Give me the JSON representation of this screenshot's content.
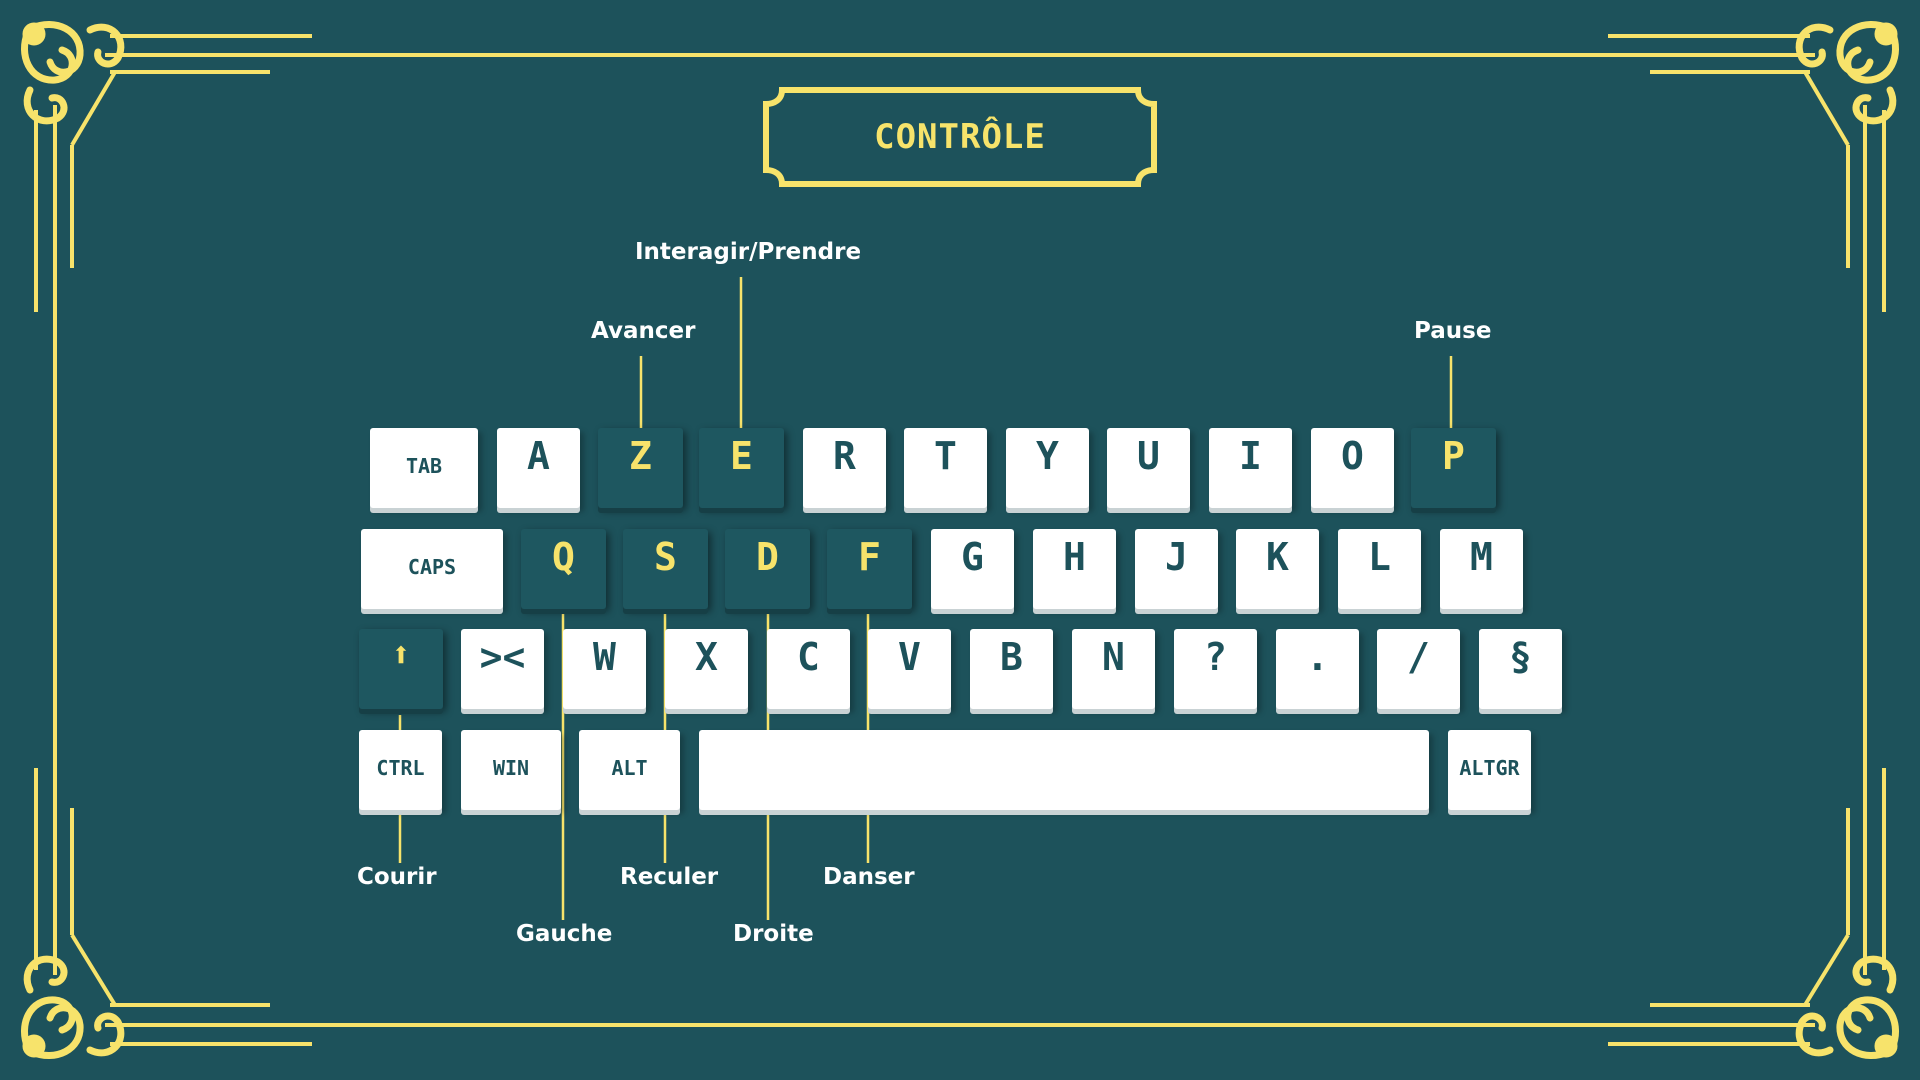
{
  "title": "CONTRÔLE",
  "colors": {
    "background": "#1d525b",
    "accent": "#f7e36b",
    "key": "#ffffff",
    "key_text": "#1d525b"
  },
  "keyboard": {
    "row1": [
      "TAB",
      "A",
      "Z",
      "E",
      "R",
      "T",
      "Y",
      "U",
      "I",
      "O",
      "P"
    ],
    "row2": [
      "CAPS",
      "Q",
      "S",
      "D",
      "F",
      "G",
      "H",
      "J",
      "K",
      "L",
      "M"
    ],
    "row3": [
      "⬆",
      "><",
      "W",
      "X",
      "C",
      "V",
      "B",
      "N",
      "?",
      ".",
      "/",
      "§"
    ],
    "row4": [
      "CTRL",
      "WIN",
      "ALT",
      "",
      "ALTGR"
    ],
    "highlighted": [
      "Z",
      "E",
      "P",
      "Q",
      "S",
      "D",
      "F",
      "⬆"
    ]
  },
  "controls": {
    "interact": "Interagir/Prendre",
    "forward": "Avancer",
    "pause": "Pause",
    "run": "Courir",
    "left": "Gauche",
    "back": "Reculer",
    "right": "Droite",
    "dance": "Danser"
  }
}
